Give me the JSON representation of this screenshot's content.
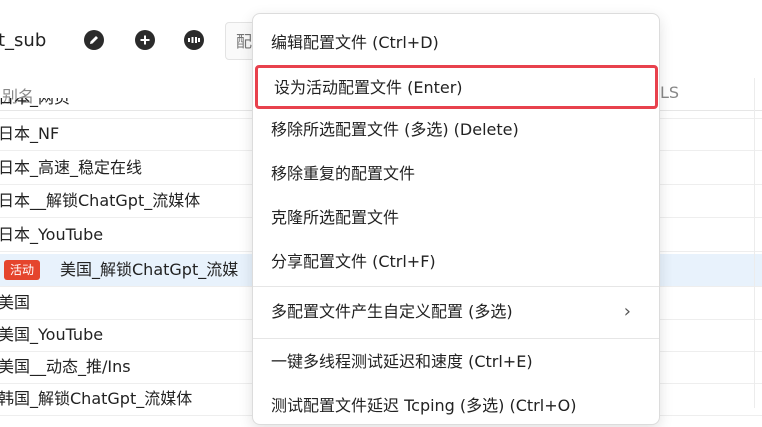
{
  "toolbar": {
    "subscription_name": "t_sub",
    "search_placeholder": "配置"
  },
  "icons": {
    "edit": "pencil-icon",
    "add": "plus-icon",
    "more": "more-icon"
  },
  "table": {
    "header_alias": "别名",
    "header_right": "LS",
    "rows": [
      {
        "name": "日本_网页"
      },
      {
        "name": "日本_NF"
      },
      {
        "name": "日本_高速_稳定在线"
      },
      {
        "name": "日本__解锁ChatGpt_流媒体"
      },
      {
        "name": "日本_YouTube"
      },
      {
        "name": "美国_解锁ChatGpt_流媒",
        "badge": "活动"
      },
      {
        "name": "美国"
      },
      {
        "name": "美国_YouTube"
      },
      {
        "name": "美国__动态_推/Ins"
      },
      {
        "name": "韩国_解锁ChatGpt_流媒体"
      }
    ]
  },
  "context_menu": {
    "items": [
      {
        "label": "编辑配置文件 (Ctrl+D)"
      },
      {
        "label": "设为活动配置文件 (Enter)"
      },
      {
        "label": "移除所选配置文件 (多选) (Delete)"
      },
      {
        "label": "移除重复的配置文件"
      },
      {
        "label": "克隆所选配置文件"
      },
      {
        "label": "分享配置文件 (Ctrl+F)"
      },
      {
        "label": "多配置文件产生自定义配置 (多选)"
      },
      {
        "label": "一键多线程测试延迟和速度 (Ctrl+E)"
      },
      {
        "label": "测试配置文件延迟 Tcping (多选) (Ctrl+O)"
      }
    ]
  },
  "colors": {
    "highlight_border": "#e8414d",
    "active_badge": "#e5452d",
    "active_row": "#e8f2fc"
  }
}
